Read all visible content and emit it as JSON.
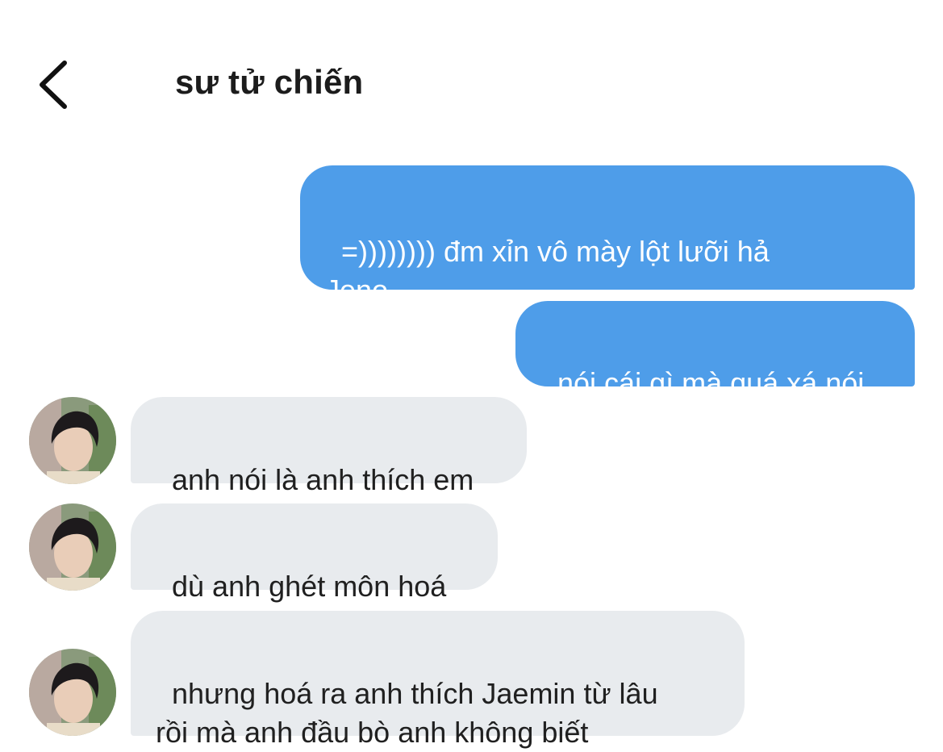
{
  "header": {
    "back_icon": "chevron-left-icon",
    "title": "sư tử chiến"
  },
  "colors": {
    "outgoing_bubble": "#4e9de9",
    "incoming_bubble": "#e8ebee",
    "outgoing_text": "#ffffff",
    "incoming_text": "#202020"
  },
  "messages": [
    {
      "direction": "outgoing",
      "text": "=)))))))) đm xỉn vô mày lột lưỡi hả\nJeno"
    },
    {
      "direction": "outgoing",
      "text": "nói cái gì mà quá xá nói"
    },
    {
      "direction": "incoming",
      "avatar": "contact-avatar",
      "text": "anh nói là anh thích em"
    },
    {
      "direction": "incoming",
      "avatar": "contact-avatar",
      "text": "dù anh ghét môn hoá"
    },
    {
      "direction": "incoming",
      "avatar": "contact-avatar",
      "text": "nhưng hoá ra anh thích Jaemin từ lâu\nrồi mà anh đầu bò anh không biết"
    }
  ]
}
